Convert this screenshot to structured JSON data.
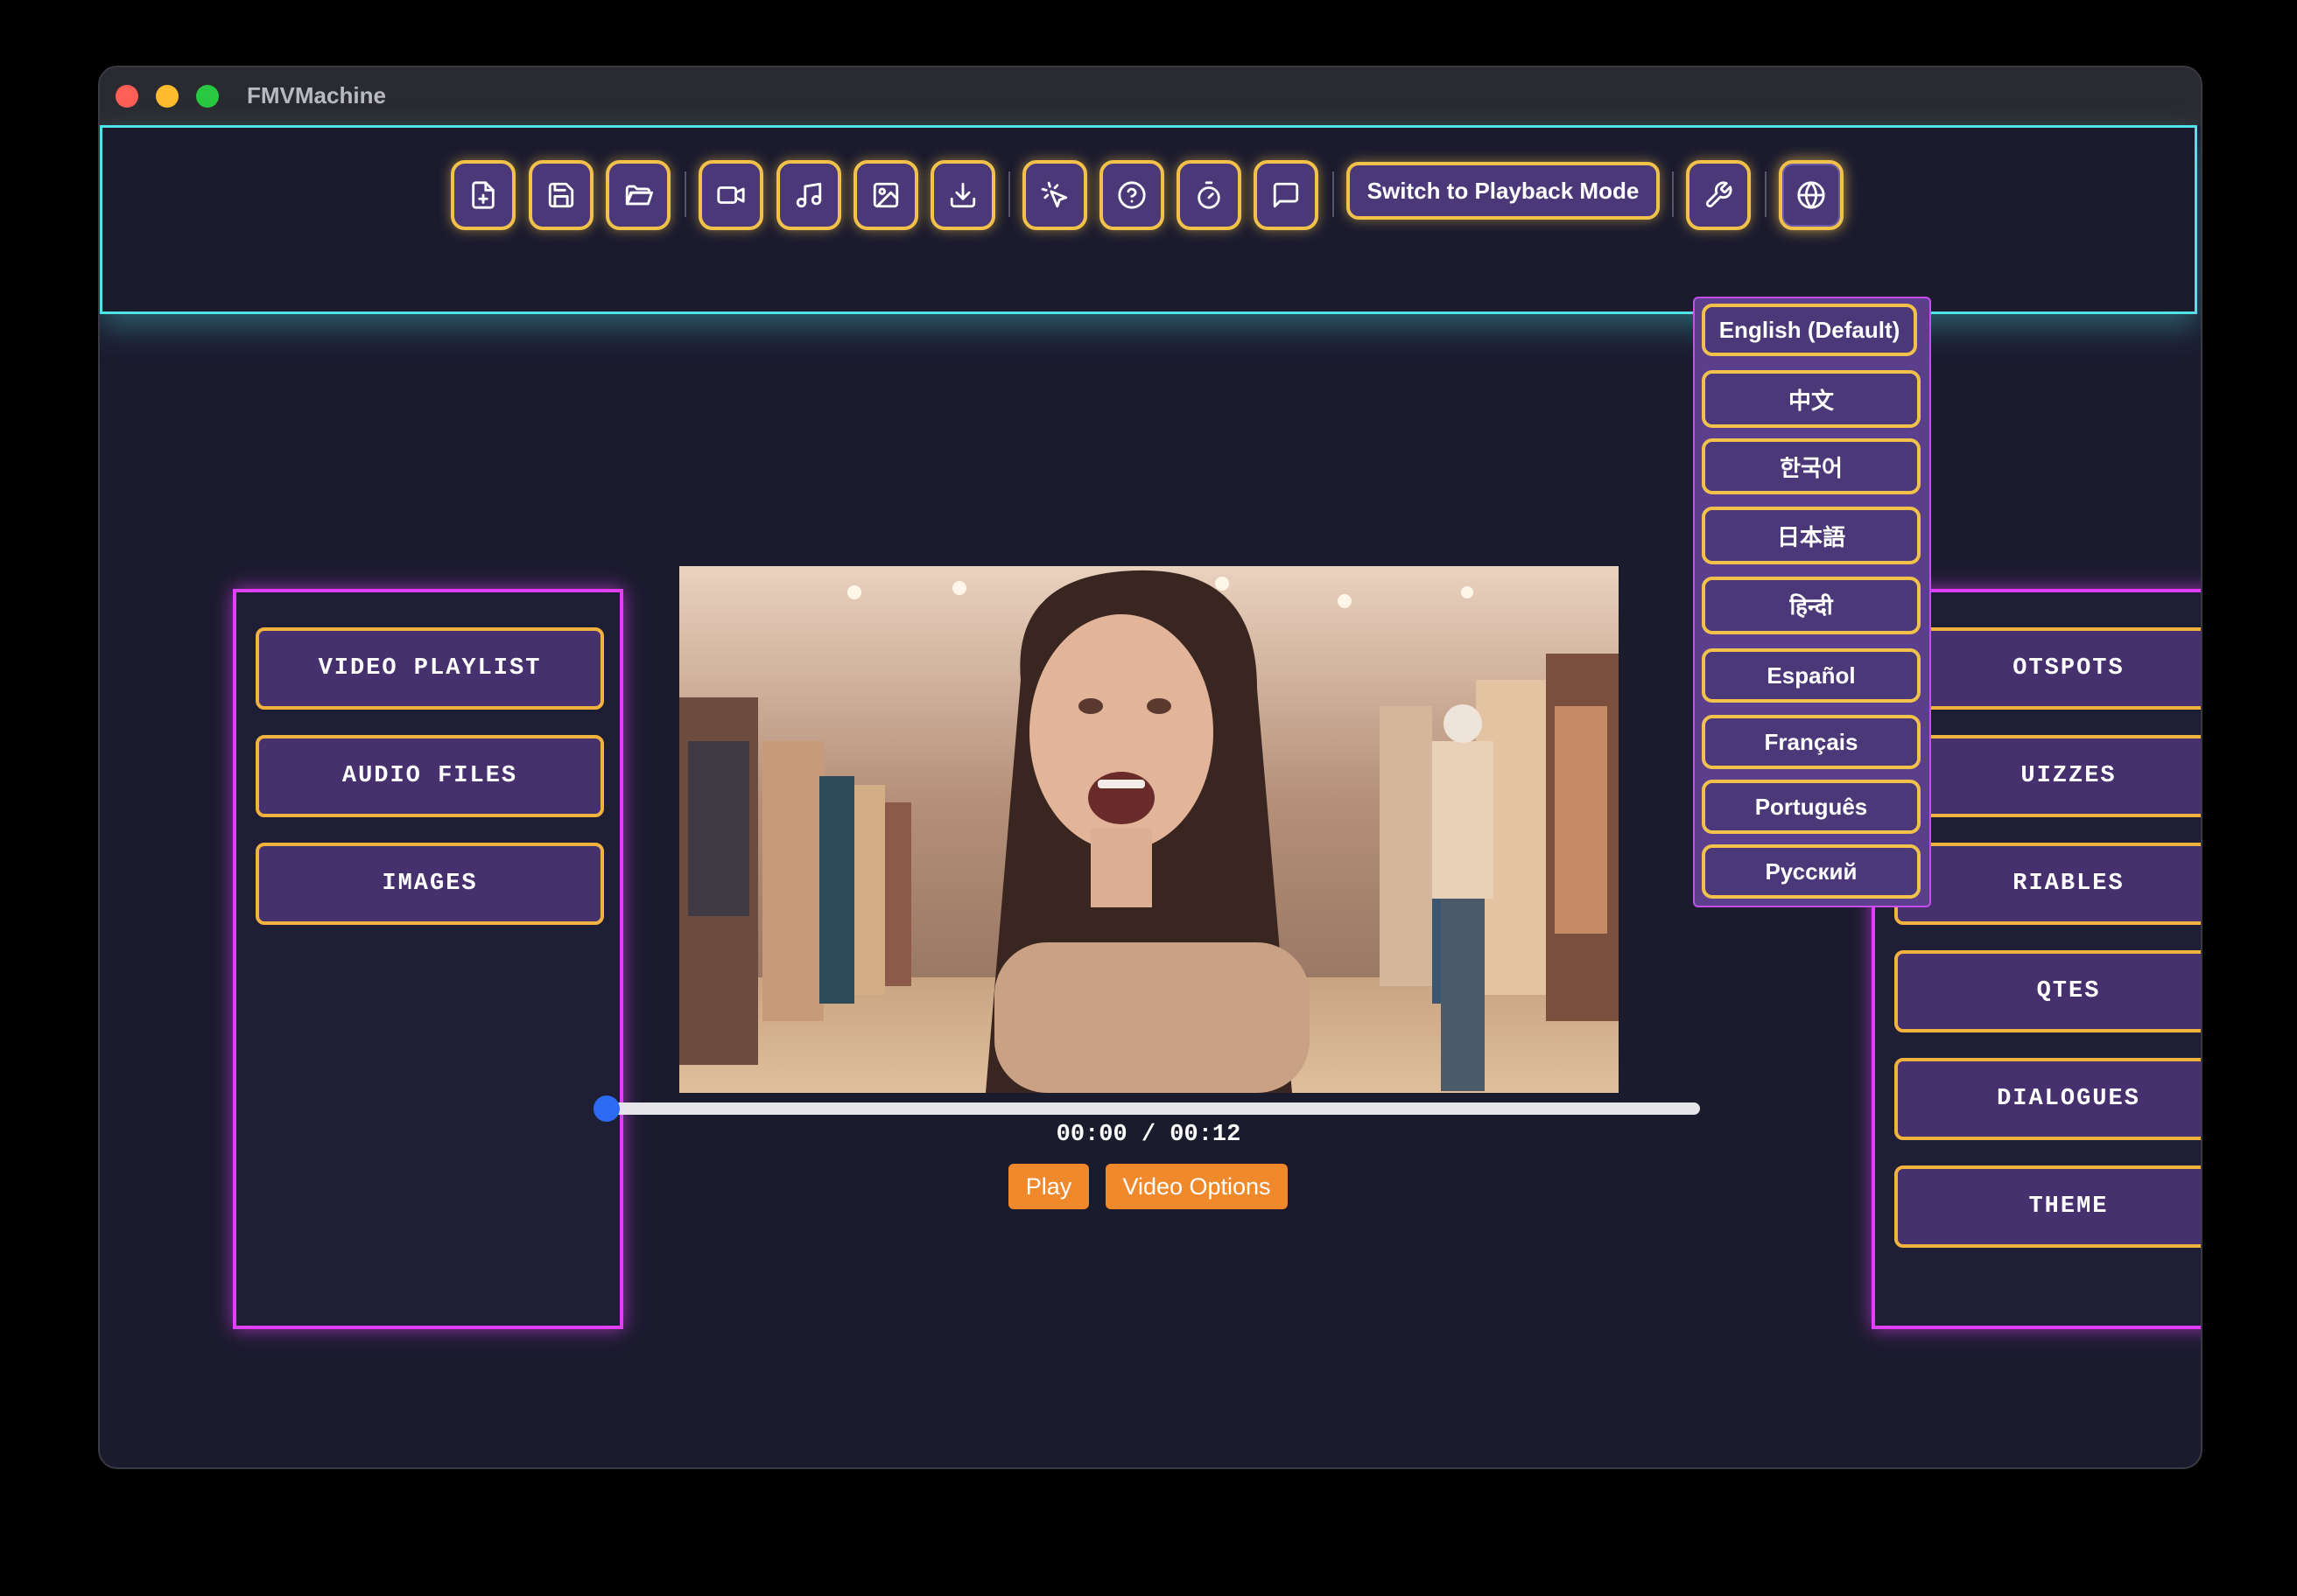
{
  "window": {
    "title": "FMVMachine"
  },
  "toolbar": {
    "icons": [
      "new-file-icon",
      "save-icon",
      "open-folder-icon",
      "video-icon",
      "music-icon",
      "image-icon",
      "download-icon",
      "pointer-icon",
      "help-icon",
      "timer-icon",
      "chat-icon"
    ],
    "mode_button": "Switch to Playback Mode",
    "settings_icon": "wrench-icon",
    "language_icon": "globe-icon"
  },
  "left_panel": {
    "items": [
      "VIDEO PLAYLIST",
      "AUDIO FILES",
      "IMAGES"
    ]
  },
  "right_panel": {
    "items": [
      "OTSPOTS",
      "UIZZES",
      "RIABLES",
      "QTES",
      "DIALOGUES",
      "THEME"
    ]
  },
  "player": {
    "timecode": "00:00 / 00:12",
    "progress": 0,
    "play_label": "Play",
    "options_label": "Video Options"
  },
  "language_menu": {
    "items": [
      "English (Default)",
      "中文",
      "한국어",
      "日本語",
      "हिन्दी",
      "Español",
      "Français",
      "Português",
      "Русский"
    ]
  },
  "colors": {
    "accent_cyan": "#4fe3e8",
    "accent_magenta": "#e040fb",
    "accent_gold": "#f2c14a",
    "button_purple": "#4a3878",
    "orange": "#f0892c"
  }
}
